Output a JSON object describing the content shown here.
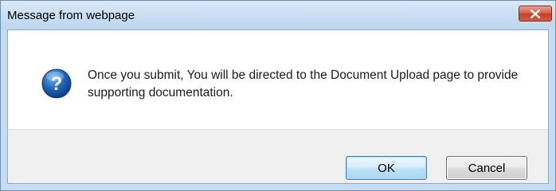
{
  "dialog": {
    "title": "Message from webpage",
    "icon": "question-icon",
    "message": "Once you submit, You will be directed to the Document Upload page to provide supporting documentation.",
    "buttons": {
      "ok_label": "OK",
      "cancel_label": "Cancel"
    }
  },
  "colors": {
    "titlebar": "#cadff3",
    "close_button": "#c24127",
    "icon_blue": "#1e5fb4",
    "footer": "#f0f0f0"
  }
}
